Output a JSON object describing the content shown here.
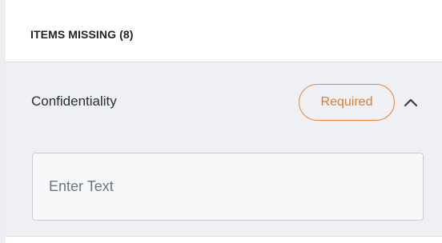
{
  "header": {
    "title": "ITEMS MISSING (8)"
  },
  "section": {
    "label": "Confidentiality",
    "badge": "Required",
    "toggle_icon": "chevron-up-icon",
    "input": {
      "value": "",
      "placeholder": "Enter Text"
    }
  },
  "colors": {
    "accent": "#e7873d",
    "section_bg": "#eef0f3",
    "border": "#d6d9de"
  }
}
